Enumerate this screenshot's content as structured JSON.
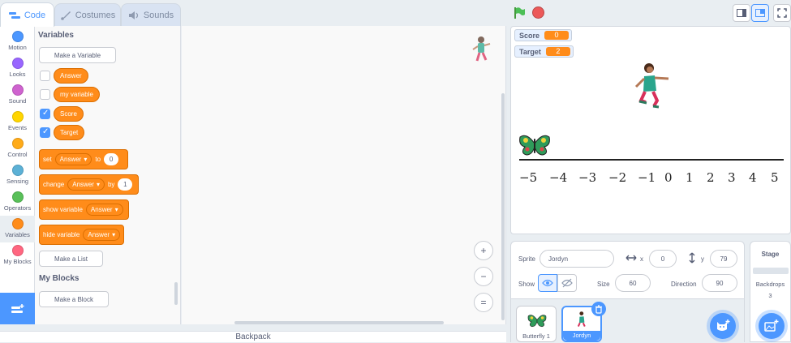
{
  "tabs": [
    {
      "label": "Code",
      "icon": "code-icon",
      "active": true
    },
    {
      "label": "Costumes",
      "icon": "brush-icon",
      "active": false
    },
    {
      "label": "Sounds",
      "icon": "speaker-icon",
      "active": false
    }
  ],
  "categories": [
    {
      "label": "Motion",
      "color": "#4c97ff"
    },
    {
      "label": "Looks",
      "color": "#9966ff"
    },
    {
      "label": "Sound",
      "color": "#cf63cf"
    },
    {
      "label": "Events",
      "color": "#ffd500"
    },
    {
      "label": "Control",
      "color": "#ffab19"
    },
    {
      "label": "Sensing",
      "color": "#5cb1d6"
    },
    {
      "label": "Operators",
      "color": "#59c059"
    },
    {
      "label": "Variables",
      "color": "#ff8c1a"
    },
    {
      "label": "My Blocks",
      "color": "#ff6680"
    }
  ],
  "palette": {
    "variables_title": "Variables",
    "make_variable": "Make a Variable",
    "variables": [
      {
        "name": "Answer",
        "checked": false
      },
      {
        "name": "my variable",
        "checked": false
      },
      {
        "name": "Score",
        "checked": true
      },
      {
        "name": "Target",
        "checked": true
      }
    ],
    "set_block": {
      "label": "set",
      "var": "Answer",
      "to": "to",
      "value": "0"
    },
    "change_block": {
      "label": "change",
      "var": "Answer",
      "by": "by",
      "value": "1"
    },
    "show_block": {
      "label": "show variable",
      "var": "Answer"
    },
    "hide_block": {
      "label": "hide variable",
      "var": "Answer"
    },
    "make_list": "Make a List",
    "myblocks_title": "My Blocks",
    "make_block": "Make a Block"
  },
  "workspace": {
    "zoom_in": "+",
    "zoom_out": "−",
    "zoom_reset": "="
  },
  "backpack": "Backpack",
  "stage": {
    "monitors": [
      {
        "label": "Score",
        "value": "0"
      },
      {
        "label": "Target",
        "value": "2"
      }
    ],
    "number_line": [
      "−5",
      "−4",
      "−3",
      "−2",
      "−1",
      "0",
      "1",
      "2",
      "3",
      "4",
      "5"
    ]
  },
  "sprite_info": {
    "sprite_label": "Sprite",
    "sprite_name": "Jordyn",
    "x_label": "x",
    "x": "0",
    "y_label": "y",
    "y": "79",
    "show_label": "Show",
    "size_label": "Size",
    "size": "60",
    "direction_label": "Direction",
    "direction": "90"
  },
  "sprites": [
    {
      "name": "Butterfly 1",
      "selected": false
    },
    {
      "name": "Jordyn",
      "selected": true
    }
  ],
  "stage_panel": {
    "title": "Stage",
    "backdrops_label": "Backdrops",
    "backdrops_count": "3"
  },
  "colors": {
    "accent": "#4c97ff",
    "variables": "#ff8c1a"
  }
}
